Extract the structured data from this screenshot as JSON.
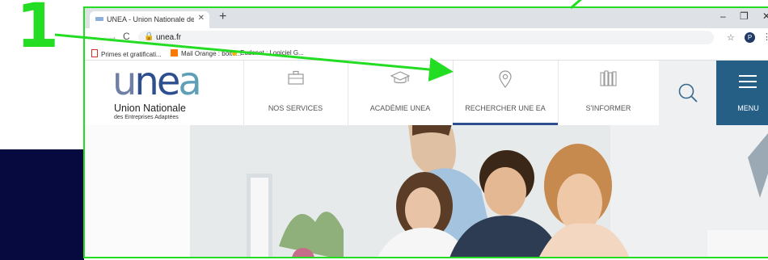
{
  "annotation": {
    "step_number": "1",
    "highlight_color": "#22dd22",
    "arrow_target": "RECHERCHER UNE EA"
  },
  "browser": {
    "tab_title": "UNEA - Union Nationale des Ent",
    "tab_close_icon": "close-icon",
    "new_tab_symbol": "+",
    "window_controls": {
      "minimize": "–",
      "maximize": "❐",
      "close": "✕"
    },
    "nav": {
      "back": "←",
      "forward": "→",
      "reload": "C"
    },
    "url": "unea.fr",
    "profile_initial": "P",
    "bookmarks": [
      {
        "label": "Primes et gratificati...",
        "icon": "document-icon",
        "color": "#d93025"
      },
      {
        "label": "Mail Orange : boite...",
        "icon": "mail-icon",
        "color": "#ff7900"
      },
      {
        "label": "Eudonet : Logiciel G...",
        "icon": "logo-icon",
        "color": "#f5b400"
      }
    ]
  },
  "site": {
    "logo": {
      "word_u": "u",
      "word_ne": "ne",
      "word_a": "a",
      "line1": "Union Nationale",
      "line2": "des Entreprises Adaptées"
    },
    "nav": [
      {
        "label": "NOS SERVICES",
        "icon": "briefcase-icon"
      },
      {
        "label": "ACADÉMIE UNEA",
        "icon": "graduation-cap-icon"
      },
      {
        "label": "RECHERCHER UNE EA",
        "icon": "location-pin-icon",
        "active": true
      },
      {
        "label": "S'INFORMER",
        "icon": "books-icon"
      }
    ],
    "search_icon": "search-icon",
    "menu_label": "MENU",
    "accent_color": "#255f86"
  }
}
